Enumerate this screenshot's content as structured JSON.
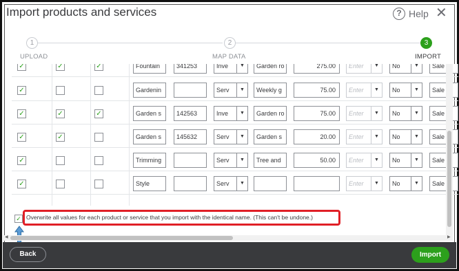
{
  "dialog": {
    "title": "Import products and services",
    "help_label": "Help",
    "close_icon": "close-icon"
  },
  "steps": [
    {
      "number": "1",
      "label": "UPLOAD",
      "active": false
    },
    {
      "number": "2",
      "label": "MAP DATA",
      "active": false
    },
    {
      "number": "3",
      "label": "IMPORT",
      "active": true
    }
  ],
  "rows": [
    {
      "c1": true,
      "c2": true,
      "c3": true,
      "name": "Fountain",
      "sku": "341253",
      "type": "Inve",
      "desc": "Garden ro",
      "price": "275.00",
      "income_placeholder": "Enter",
      "taxable": "No",
      "account": "Sale"
    },
    {
      "c1": true,
      "c2": false,
      "c3": false,
      "name": "Gardenin",
      "sku": "",
      "type": "Serv",
      "desc": "Weekly g",
      "price": "75.00",
      "income_placeholder": "Enter",
      "taxable": "No",
      "account": "Sale"
    },
    {
      "c1": true,
      "c2": true,
      "c3": true,
      "name": "Garden s",
      "sku": "142563",
      "type": "Inve",
      "desc": "Garden ro",
      "price": "75.00",
      "income_placeholder": "Enter",
      "taxable": "No",
      "account": "Sale"
    },
    {
      "c1": true,
      "c2": true,
      "c3": false,
      "name": "Garden s",
      "sku": "145632",
      "type": "Serv",
      "desc": "Garden s",
      "price": "20.00",
      "income_placeholder": "Enter",
      "taxable": "No",
      "account": "Sale"
    },
    {
      "c1": true,
      "c2": false,
      "c3": false,
      "name": "Trimming",
      "sku": "",
      "type": "Serv",
      "desc": "Tree and",
      "price": "50.00",
      "income_placeholder": "Enter",
      "taxable": "No",
      "account": "Sale"
    },
    {
      "c1": true,
      "c2": false,
      "c3": false,
      "name": "Style",
      "sku": "",
      "type": "Serv",
      "desc": "",
      "price": "",
      "income_placeholder": "Enter",
      "taxable": "No",
      "account": "Sale"
    }
  ],
  "overwrite": {
    "checked": true,
    "label": "Overwrite all values for each product or service that you import with the identical name. (This can't be undone.)"
  },
  "footer": {
    "back_label": "Back",
    "import_label": "Import"
  },
  "colors": {
    "brand_green": "#2ca01c",
    "footer_bg": "#393a3d",
    "highlight_red": "#e01f26",
    "arrow_blue": "#5b9bd5"
  }
}
